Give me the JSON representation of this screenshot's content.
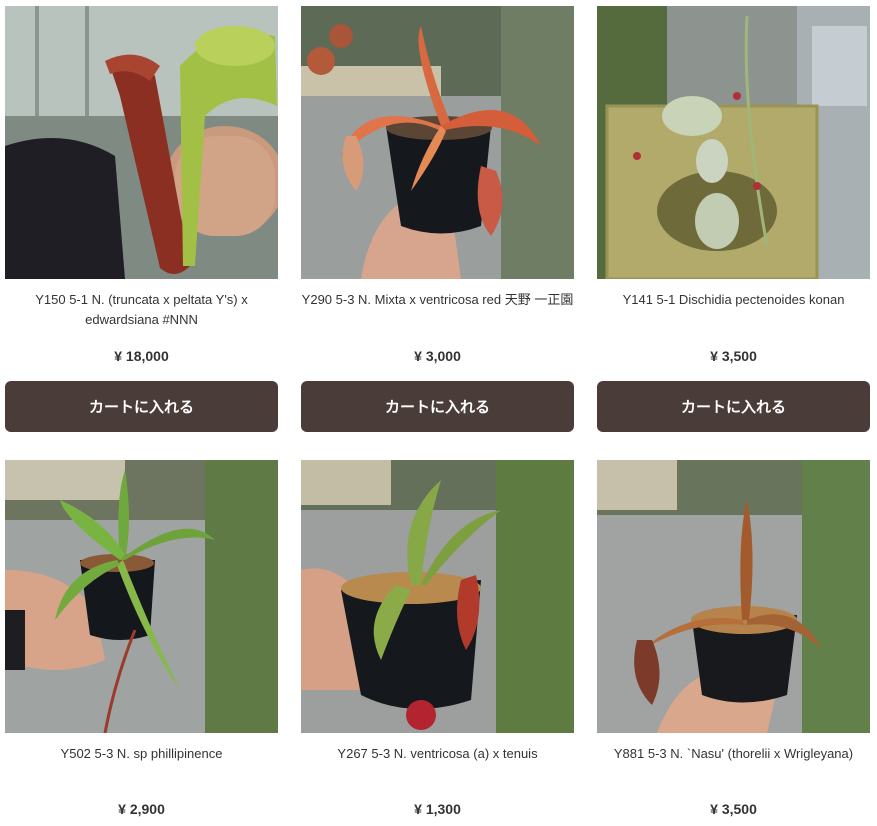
{
  "products": [
    {
      "title": "Y150 5-1 N. (truncata x peltata Y's) x edwardsiana #NNN",
      "price": "¥ 18,000",
      "cart_label": "カートに入れる"
    },
    {
      "title": "Y290 5-3 N. Mixta x ventricosa red 天野 一正園",
      "price": "¥ 3,000",
      "cart_label": "カートに入れる"
    },
    {
      "title": "Y141 5-1 Dischidia pectenoides konan",
      "price": "¥ 3,500",
      "cart_label": "カートに入れる"
    },
    {
      "title": "Y502 5-3 N. sp phillipinence",
      "price": "¥ 2,900"
    },
    {
      "title": "Y267 5-3 N. ventricosa (a) x tenuis",
      "price": "¥ 1,300"
    },
    {
      "title": "Y881 5-3 N. `Nasu' (thorelii x Wrigleyana)",
      "price": "¥ 3,500"
    }
  ]
}
